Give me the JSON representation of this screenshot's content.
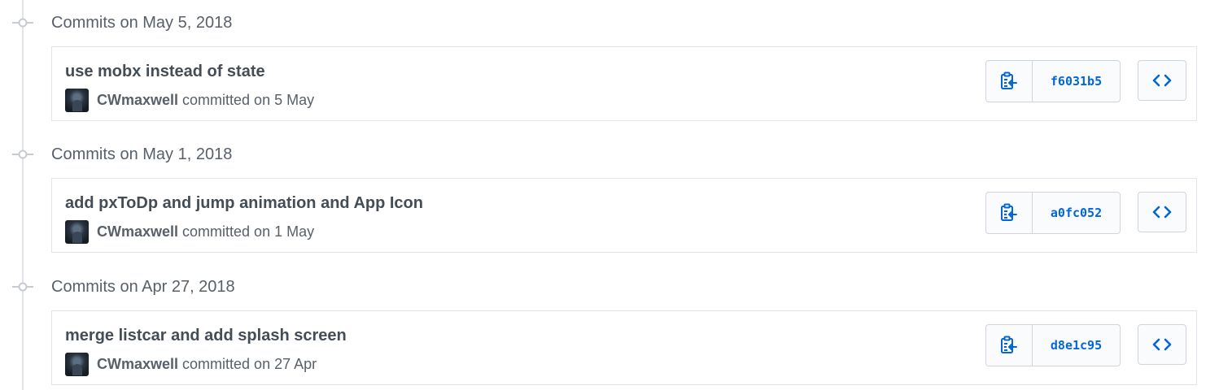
{
  "groups": [
    {
      "title": "Commits on May 5, 2018",
      "commit": {
        "message": "use mobx instead of state",
        "author": "CWmaxwell",
        "committed_text": "committed on 5 May",
        "sha": "f6031b5"
      }
    },
    {
      "title": "Commits on May 1, 2018",
      "commit": {
        "message": "add pxToDp and jump animation and App Icon",
        "author": "CWmaxwell",
        "committed_text": "committed on 1 May",
        "sha": "a0fc052"
      }
    },
    {
      "title": "Commits on Apr 27, 2018",
      "commit": {
        "message": "merge listcar and add splash screen",
        "author": "CWmaxwell",
        "committed_text": "committed on 27 Apr",
        "sha": "d8e1c95"
      }
    }
  ],
  "icons": {
    "timeline_node": "git-commit-icon",
    "copy": "clipboard-icon",
    "browse": "code-icon"
  },
  "colors": {
    "link": "#0366d6",
    "muted_text": "#586069",
    "border": "#e1e4e8"
  }
}
